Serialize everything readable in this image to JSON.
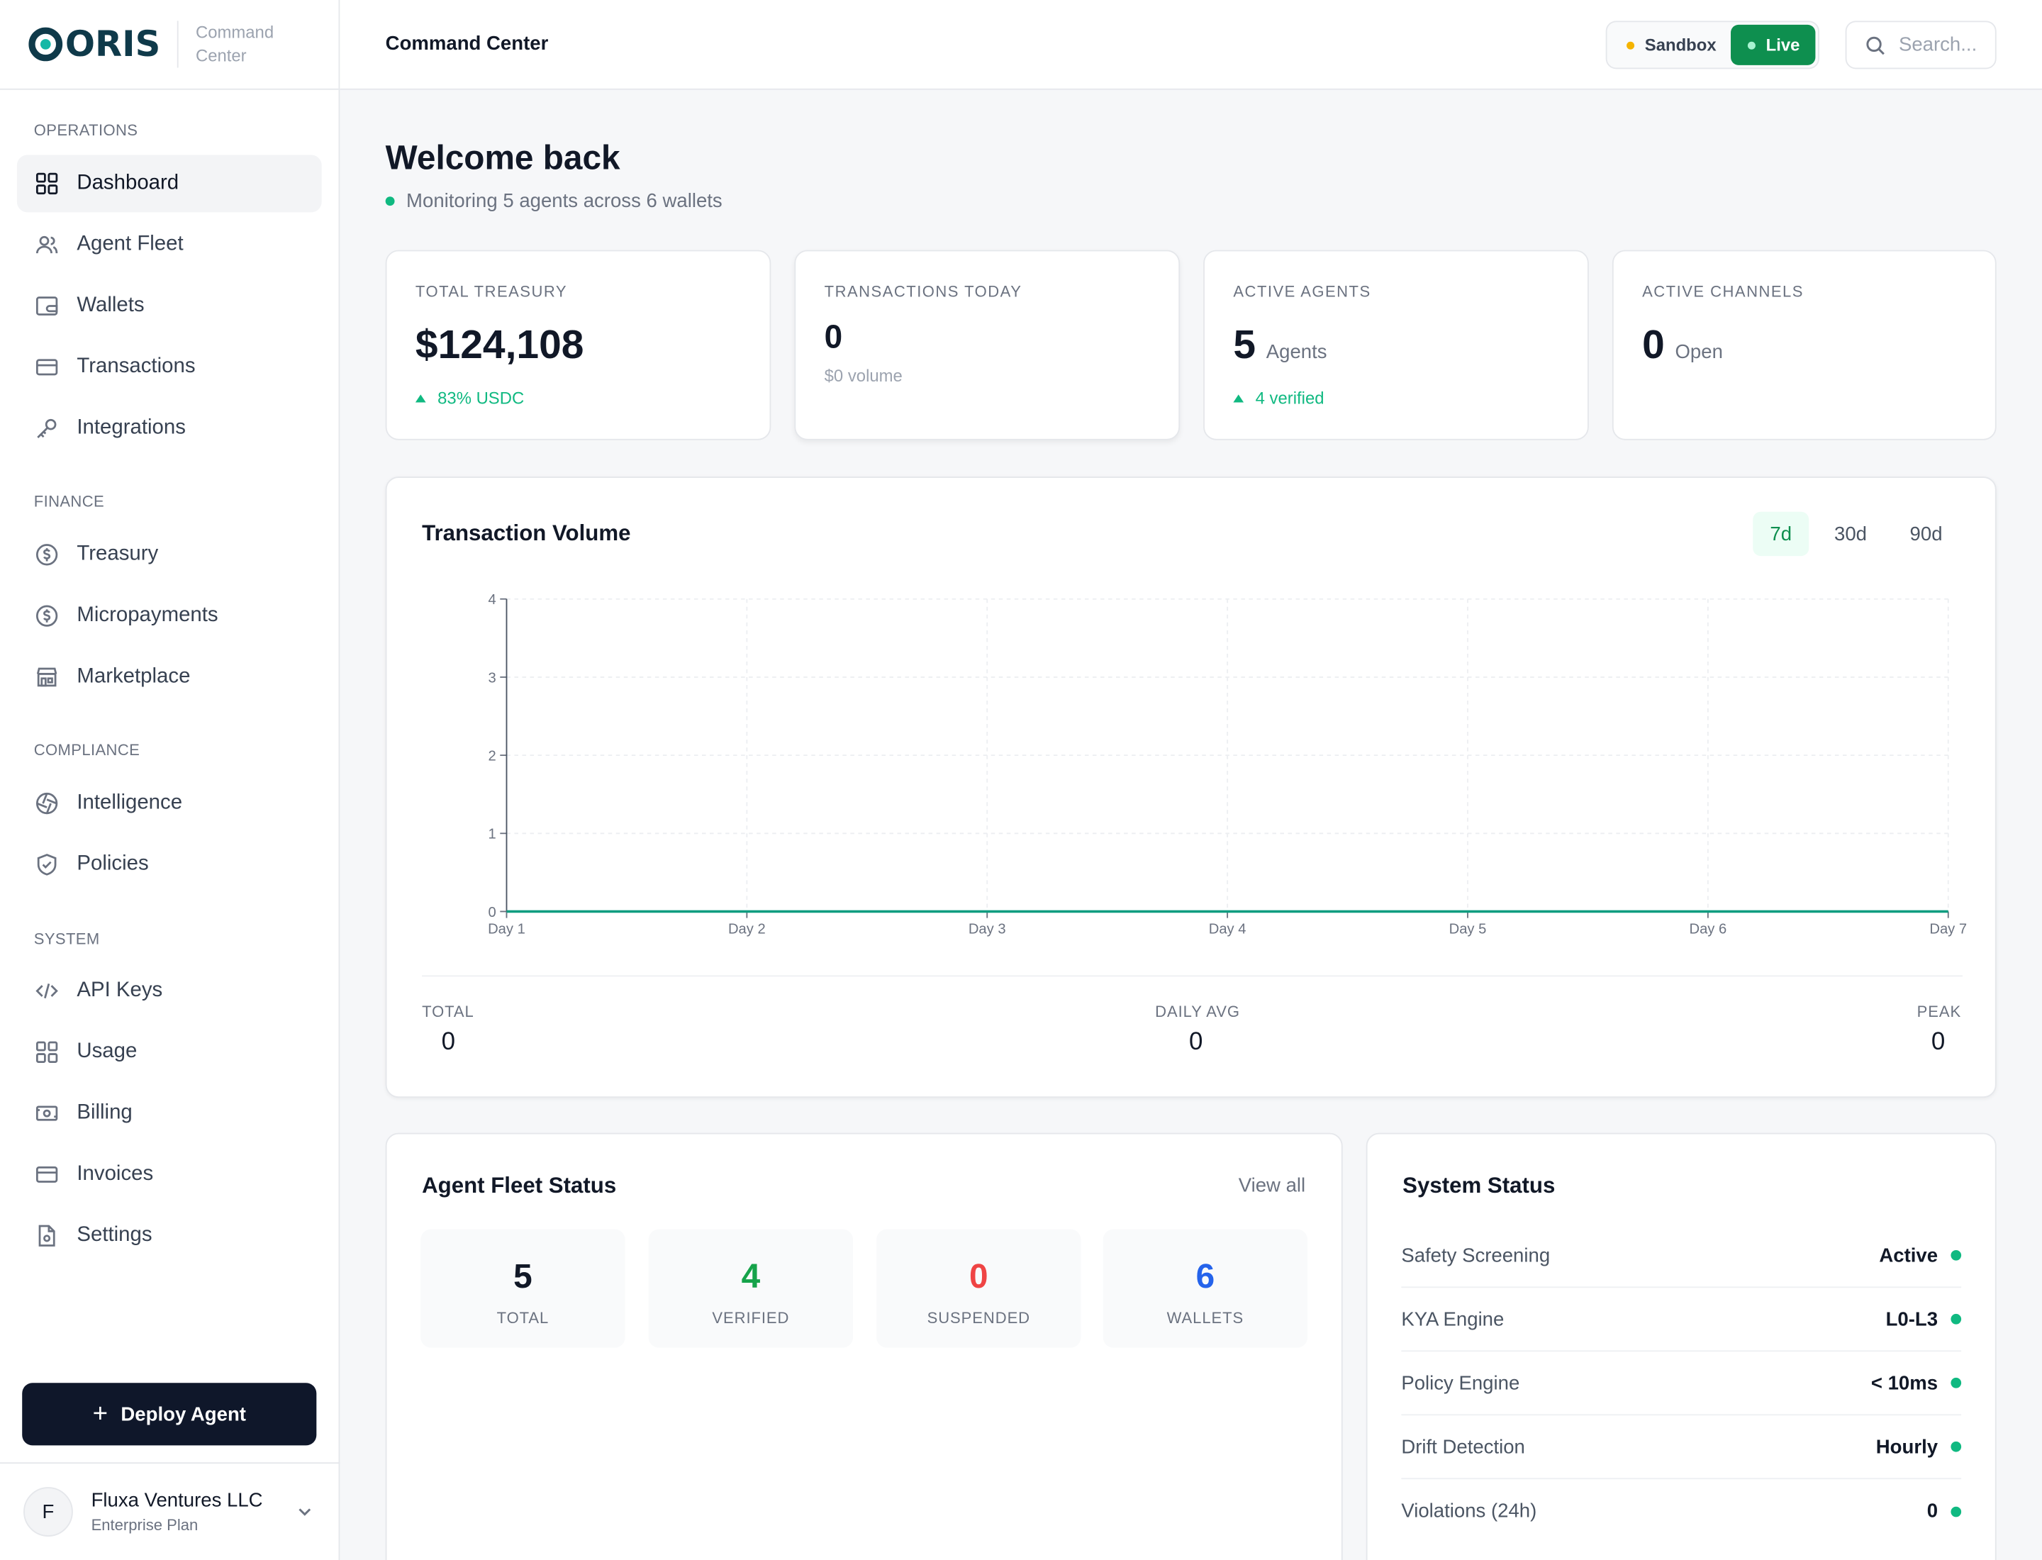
{
  "brand": {
    "logo_text": "ORIS",
    "subtitle": "Command Center"
  },
  "sidebar": {
    "sections": {
      "operations": "OPERATIONS",
      "finance": "FINANCE",
      "compliance": "COMPLIANCE",
      "system": "SYSTEM"
    },
    "items": {
      "dashboard": "Dashboard",
      "agent_fleet": "Agent Fleet",
      "wallets": "Wallets",
      "transactions": "Transactions",
      "integrations": "Integrations",
      "treasury": "Treasury",
      "micropayments": "Micropayments",
      "marketplace": "Marketplace",
      "intelligence": "Intelligence",
      "policies": "Policies",
      "api_keys": "API Keys",
      "usage": "Usage",
      "billing": "Billing",
      "invoices": "Invoices",
      "settings": "Settings"
    },
    "deploy_label": "Deploy Agent",
    "org": {
      "initial": "F",
      "name": "Fluxa Ventures LLC",
      "plan": "Enterprise Plan"
    }
  },
  "topbar": {
    "title": "Command Center",
    "env_sandbox": "Sandbox",
    "env_live": "Live",
    "search_placeholder": "Search..."
  },
  "main": {
    "welcome": "Welcome back",
    "subtitle": "Monitoring 5 agents across 6 wallets",
    "stats": {
      "treasury": {
        "label": "TOTAL TREASURY",
        "value": "$124,108",
        "sub": "83% USDC"
      },
      "tx_today": {
        "label": "TRANSACTIONS TODAY",
        "value": "0",
        "sub": "$0 volume"
      },
      "agents": {
        "label": "ACTIVE AGENTS",
        "value": "5",
        "unit": "Agents",
        "sub": "4 verified"
      },
      "channels": {
        "label": "ACTIVE CHANNELS",
        "value": "0",
        "unit": "Open"
      }
    },
    "volume": {
      "title": "Transaction Volume",
      "ranges": [
        "7d",
        "30d",
        "90d"
      ],
      "selected_range": "7d",
      "footer": {
        "total_label": "TOTAL",
        "total": "0",
        "avg_label": "DAILY AVG",
        "avg": "0",
        "peak_label": "PEAK",
        "peak": "0"
      }
    },
    "fleet": {
      "title": "Agent Fleet Status",
      "view_all": "View all",
      "boxes": [
        {
          "value": "5",
          "label": "TOTAL",
          "color": "#111827"
        },
        {
          "value": "4",
          "label": "VERIFIED",
          "color": "#16a34a"
        },
        {
          "value": "0",
          "label": "SUSPENDED",
          "color": "#ef4444"
        },
        {
          "value": "6",
          "label": "WALLETS",
          "color": "#2563eb"
        }
      ]
    },
    "system": {
      "title": "System Status",
      "rows": [
        {
          "label": "Safety Screening",
          "value": "Active"
        },
        {
          "label": "KYA Engine",
          "value": "L0-L3"
        },
        {
          "label": "Policy Engine",
          "value": "< 10ms"
        },
        {
          "label": "Drift Detection",
          "value": "Hourly"
        },
        {
          "label": "Violations (24h)",
          "value": "0"
        }
      ]
    }
  },
  "chart_data": {
    "type": "line",
    "categories": [
      "Day 1",
      "Day 2",
      "Day 3",
      "Day 4",
      "Day 5",
      "Day 6",
      "Day 7"
    ],
    "values": [
      0,
      0,
      0,
      0,
      0,
      0,
      0
    ],
    "ylim": [
      0,
      4
    ],
    "yticks": [
      "0",
      "1",
      "2",
      "3",
      "4"
    ],
    "grid": true,
    "line_color": "#0f9d80"
  },
  "colors": {
    "accent_green": "#0e8f4f",
    "sandbox_dot": "#f59e0b",
    "status_green": "#10b981",
    "dark": "#0f172a"
  }
}
